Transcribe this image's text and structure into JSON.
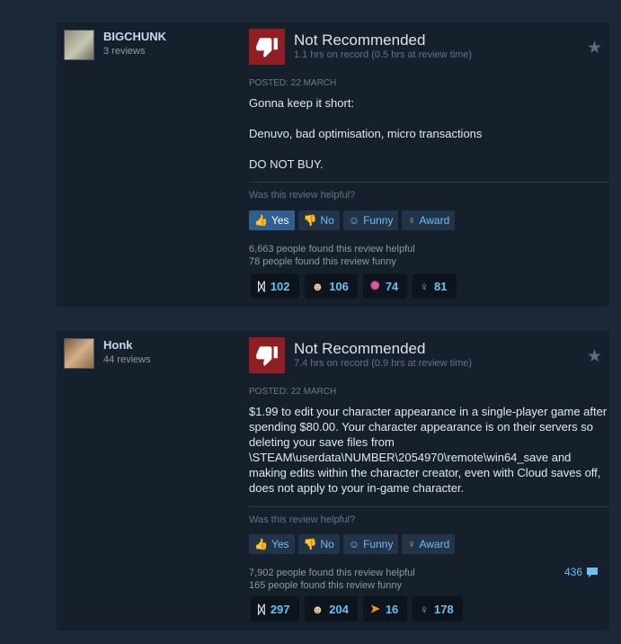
{
  "reviews": [
    {
      "username": "BIGCHUNK",
      "review_count": "3 reviews",
      "verdict": "Not Recommended",
      "hours": "1.1 hrs on record (0.5 hrs at review time)",
      "posted": "POSTED: 22 MARCH",
      "paragraphs": [
        "Gonna keep it short:",
        "Denuvo, bad optimisation, micro transactions",
        "DO NOT BUY."
      ],
      "helpful_question": "Was this review helpful?",
      "buttons": {
        "yes": "Yes",
        "no": "No",
        "funny": "Funny",
        "award": "Award"
      },
      "helpful_stat": "6,663 people found this review helpful",
      "funny_stat": "78 people found this review funny",
      "awards": [
        {
          "icon": "wings-award-icon",
          "count": "102"
        },
        {
          "icon": "clown-award-icon",
          "count": "106"
        },
        {
          "icon": "sparkle-award-icon",
          "count": "74"
        },
        {
          "icon": "medal-award-icon",
          "count": "81"
        }
      ]
    },
    {
      "username": "Honk",
      "review_count": "44 reviews",
      "verdict": "Not Recommended",
      "hours": "7.4 hrs on record (0.9 hrs at review time)",
      "posted": "POSTED: 22 MARCH",
      "paragraphs": [
        "$1.99 to edit your character appearance in a single-player game after spending $80.00. Your character appearance is on their servers so deleting your save files from \\STEAM\\userdata\\NUMBER\\2054970\\remote\\win64_save and making edits within the character creator, even with Cloud saves off, does not apply to your in-game character."
      ],
      "helpful_question": "Was this review helpful?",
      "buttons": {
        "yes": "Yes",
        "no": "No",
        "funny": "Funny",
        "award": "Award"
      },
      "helpful_stat": "7,902 people found this review helpful",
      "funny_stat": "165 people found this review funny",
      "comments": "436",
      "awards": [
        {
          "icon": "wings-award-icon",
          "count": "297"
        },
        {
          "icon": "clown-award-icon",
          "count": "204"
        },
        {
          "icon": "horn-award-icon",
          "count": "16"
        },
        {
          "icon": "medal-award-icon",
          "count": "178"
        }
      ]
    }
  ]
}
